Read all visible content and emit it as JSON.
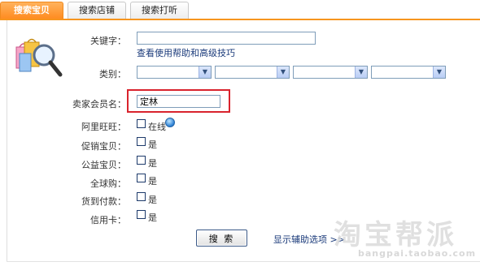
{
  "tabs": [
    {
      "label": "搜索宝贝",
      "active": true
    },
    {
      "label": "搜索店铺",
      "active": false
    },
    {
      "label": "搜索打听",
      "active": false
    }
  ],
  "form": {
    "keyword_label": "关键字：",
    "keyword_value": "",
    "help_prefix": "查看",
    "help_link": "使用帮助",
    "help_and": "和",
    "advanced_tips": "高级技巧",
    "category_label": "类别：",
    "category_selects": [
      "",
      "",
      "",
      ""
    ],
    "seller_label": "卖家会员名：",
    "seller_value": "定林",
    "wangwang_label": "阿里旺旺：",
    "wangwang_option": "在线",
    "promo_label": "促销宝贝：",
    "charity_label": "公益宝贝：",
    "global_label": "全球购：",
    "cod_label": "货到付款：",
    "credit_label": "信用卡：",
    "yes": "是"
  },
  "actions": {
    "search_label": "搜 索",
    "show_more": "显示辅助选项 >>"
  },
  "watermark": {
    "text": "淘宝帮派",
    "url": "bangpai.taobao.com"
  },
  "colors": {
    "accent": "#f7951f",
    "highlight": "#d9232d",
    "link": "#1a3a7a"
  }
}
